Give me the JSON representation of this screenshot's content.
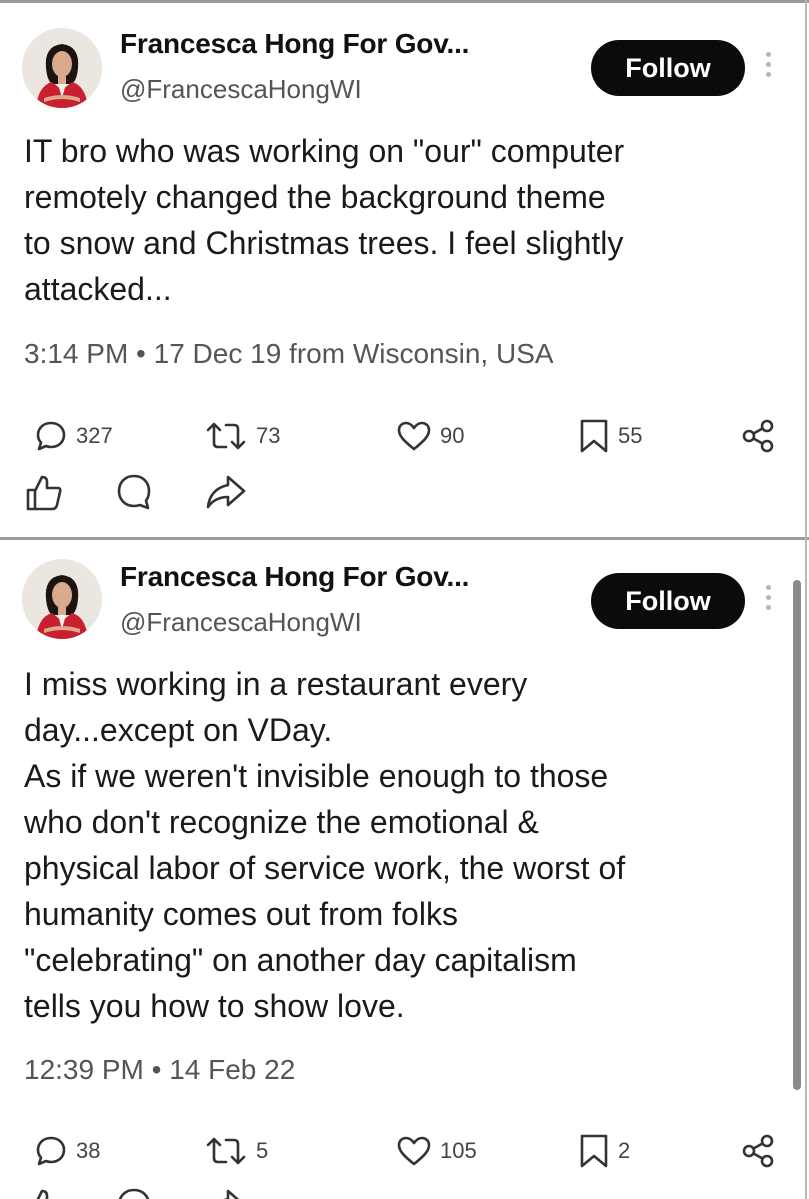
{
  "posts": [
    {
      "author": "Francesca Hong For Gov...",
      "handle": "@FrancescaHongWI",
      "follow_label": "Follow",
      "text_lines": [
        "IT bro who was working on \"our\" computer",
        "remotely changed the background theme",
        "to snow and Christmas trees. I feel slightly",
        "attacked..."
      ],
      "meta": "3:14 PM • 17 Dec 19 from Wisconsin, USA",
      "stats": {
        "replies": "327",
        "reposts": "73",
        "likes": "90",
        "bookmarks": "55"
      }
    },
    {
      "author": "Francesca Hong For Gov...",
      "handle": "@FrancescaHongWI",
      "follow_label": "Follow",
      "text_lines": [
        "I miss working in a restaurant every",
        "day...except on VDay.",
        "As if we weren't invisible enough to those",
        "who don't recognize the emotional &",
        "physical labor of service work, the worst of",
        "humanity comes out from folks",
        "\"celebrating\" on another day capitalism",
        "tells you how to show love."
      ],
      "meta": "12:39 PM • 14 Feb 22",
      "stats": {
        "replies": "38",
        "reposts": "5",
        "likes": "105",
        "bookmarks": "2"
      }
    }
  ],
  "icons": {
    "reply": "comment-bubble-icon",
    "repost": "repost-arrows-icon",
    "like": "heart-icon",
    "bookmark": "bookmark-icon",
    "share": "share-nodes-icon",
    "thumbs_up": "thumbs-up-icon",
    "comment": "comment-circle-icon",
    "forward": "forward-arrow-icon"
  },
  "colors": {
    "follow_bg": "#0b0b0b",
    "text": "#1a1a1a",
    "muted": "#555555"
  }
}
